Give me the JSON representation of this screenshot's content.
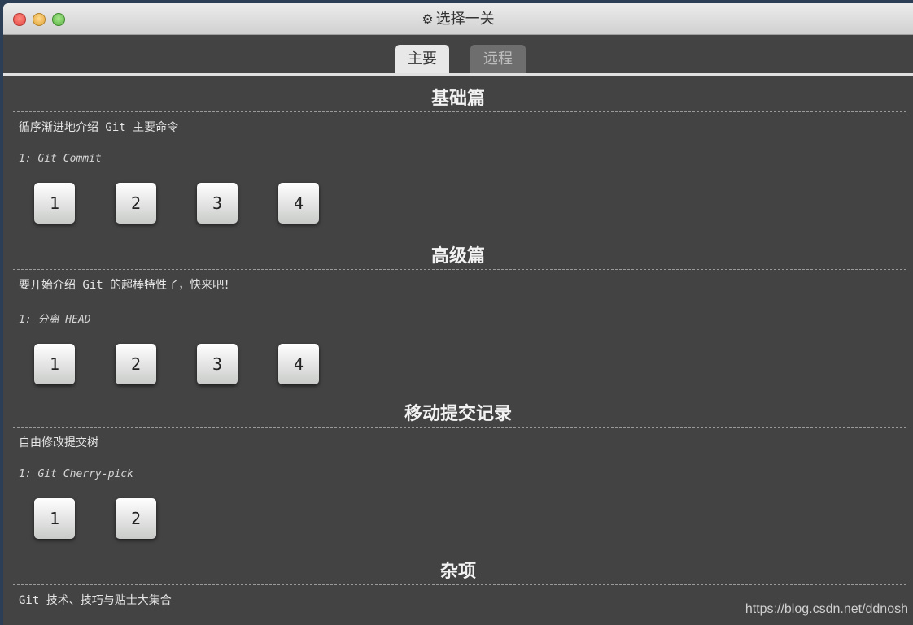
{
  "window": {
    "title": "选择一关",
    "title_icon": "gear-icon"
  },
  "tabs": [
    {
      "label": "主要",
      "active": true
    },
    {
      "label": "远程",
      "active": false
    }
  ],
  "sections": [
    {
      "title": "基础篇",
      "description": "循序渐进地介绍 Git 主要命令",
      "sequence": "1: Git Commit",
      "levels": [
        "1",
        "2",
        "3",
        "4"
      ]
    },
    {
      "title": "高级篇",
      "description": "要开始介绍 Git 的超棒特性了，快来吧！",
      "sequence": "1: 分离 HEAD",
      "levels": [
        "1",
        "2",
        "3",
        "4"
      ]
    },
    {
      "title": "移动提交记录",
      "description": "自由修改提交树",
      "sequence": "1: Git Cherry-pick",
      "levels": [
        "1",
        "2"
      ]
    },
    {
      "title": "杂项",
      "description": "Git 技术、技巧与贴士大集合"
    }
  ],
  "watermark": "https://blog.csdn.net/ddnosh"
}
